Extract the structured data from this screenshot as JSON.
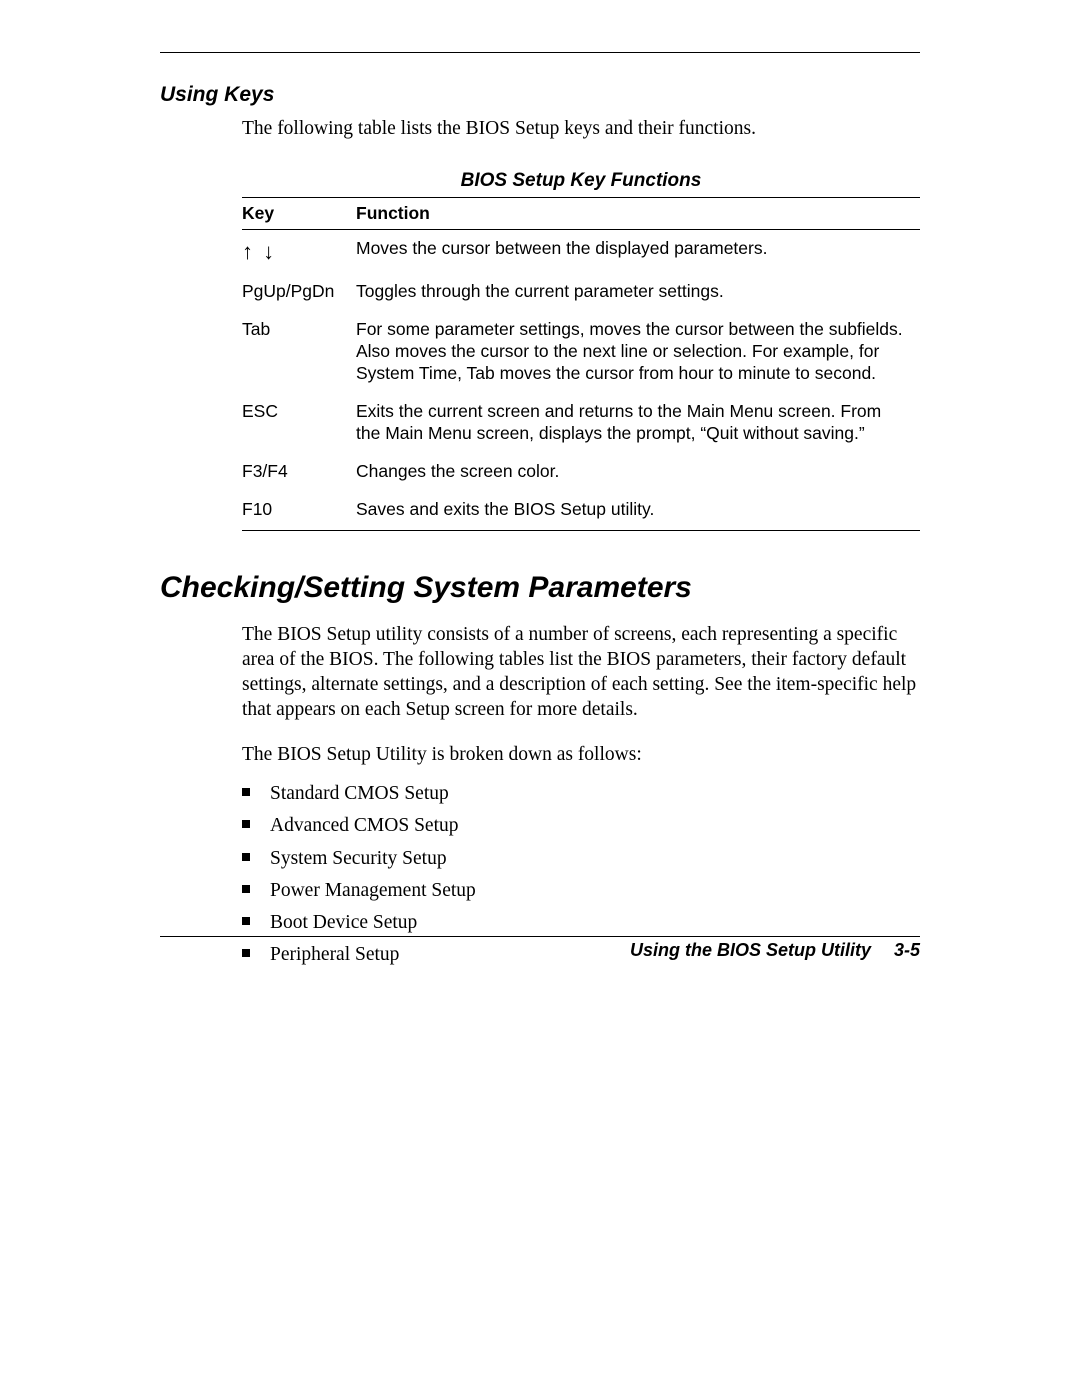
{
  "headings": {
    "sub": "Using Keys",
    "main": "Checking/Setting System Parameters",
    "tableTitle": "BIOS Setup Key Functions"
  },
  "introText": "The following table lists the BIOS Setup keys and their functions.",
  "tableHeader": {
    "col1": "Key",
    "col2": "Function"
  },
  "rows": [
    {
      "key": "↑ ↓",
      "func": "Moves the cursor between the displayed parameters."
    },
    {
      "key": "PgUp/PgDn",
      "func": "Toggles through the current parameter settings."
    },
    {
      "key": "Tab",
      "func": "For some parameter settings, moves the cursor between the subfields. Also moves the cursor to the next line or selection. For example, for System Time, Tab moves the cursor from hour to minute to second."
    },
    {
      "key": "ESC",
      "func": "Exits the current screen and returns to the Main Menu screen. From the Main Menu screen, displays the prompt, “Quit without saving.”"
    },
    {
      "key": "F3/F4",
      "func": "Changes the screen color."
    },
    {
      "key": "F10",
      "func": "Saves and exits the BIOS Setup utility."
    }
  ],
  "sectionText1": "The BIOS Setup utility consists of a number of screens, each representing a specific area of the BIOS. The following tables list the BIOS parameters, their factory default settings, alternate settings, and a description of each setting. See the item-specific help that appears on each Setup screen for more details.",
  "sectionText2": "The BIOS Setup Utility is broken down as follows:",
  "bullets": [
    "Standard CMOS Setup",
    "Advanced CMOS Setup",
    "System Security Setup",
    "Power Management Setup",
    "Boot Device Setup",
    "Peripheral Setup"
  ],
  "footer": "Using the BIOS Setup Utility  3-5"
}
